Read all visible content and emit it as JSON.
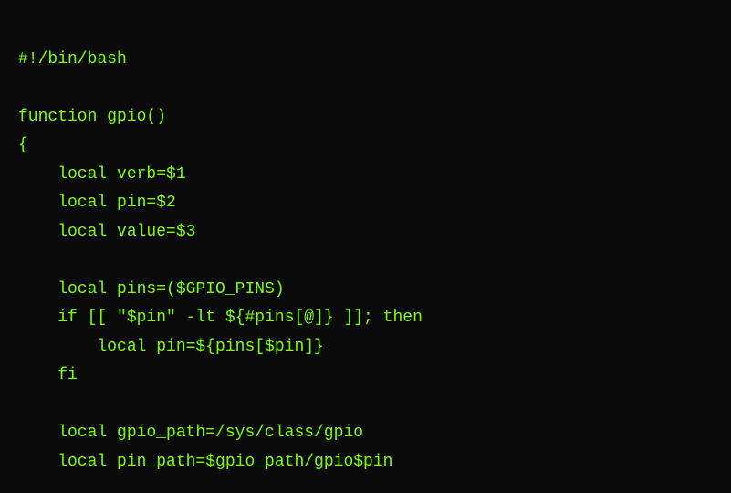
{
  "code": {
    "lines": [
      "#!/bin/bash",
      "",
      "function gpio()",
      "{",
      "    local verb=$1",
      "    local pin=$2",
      "    local value=$3",
      "",
      "    local pins=($GPIO_PINS)",
      "    if [[ \"$pin\" -lt ${#pins[@]} ]]; then",
      "        local pin=${pins[$pin]}",
      "    fi",
      "",
      "    local gpio_path=/sys/class/gpio",
      "    local pin_path=$gpio_path/gpio$pin"
    ]
  }
}
